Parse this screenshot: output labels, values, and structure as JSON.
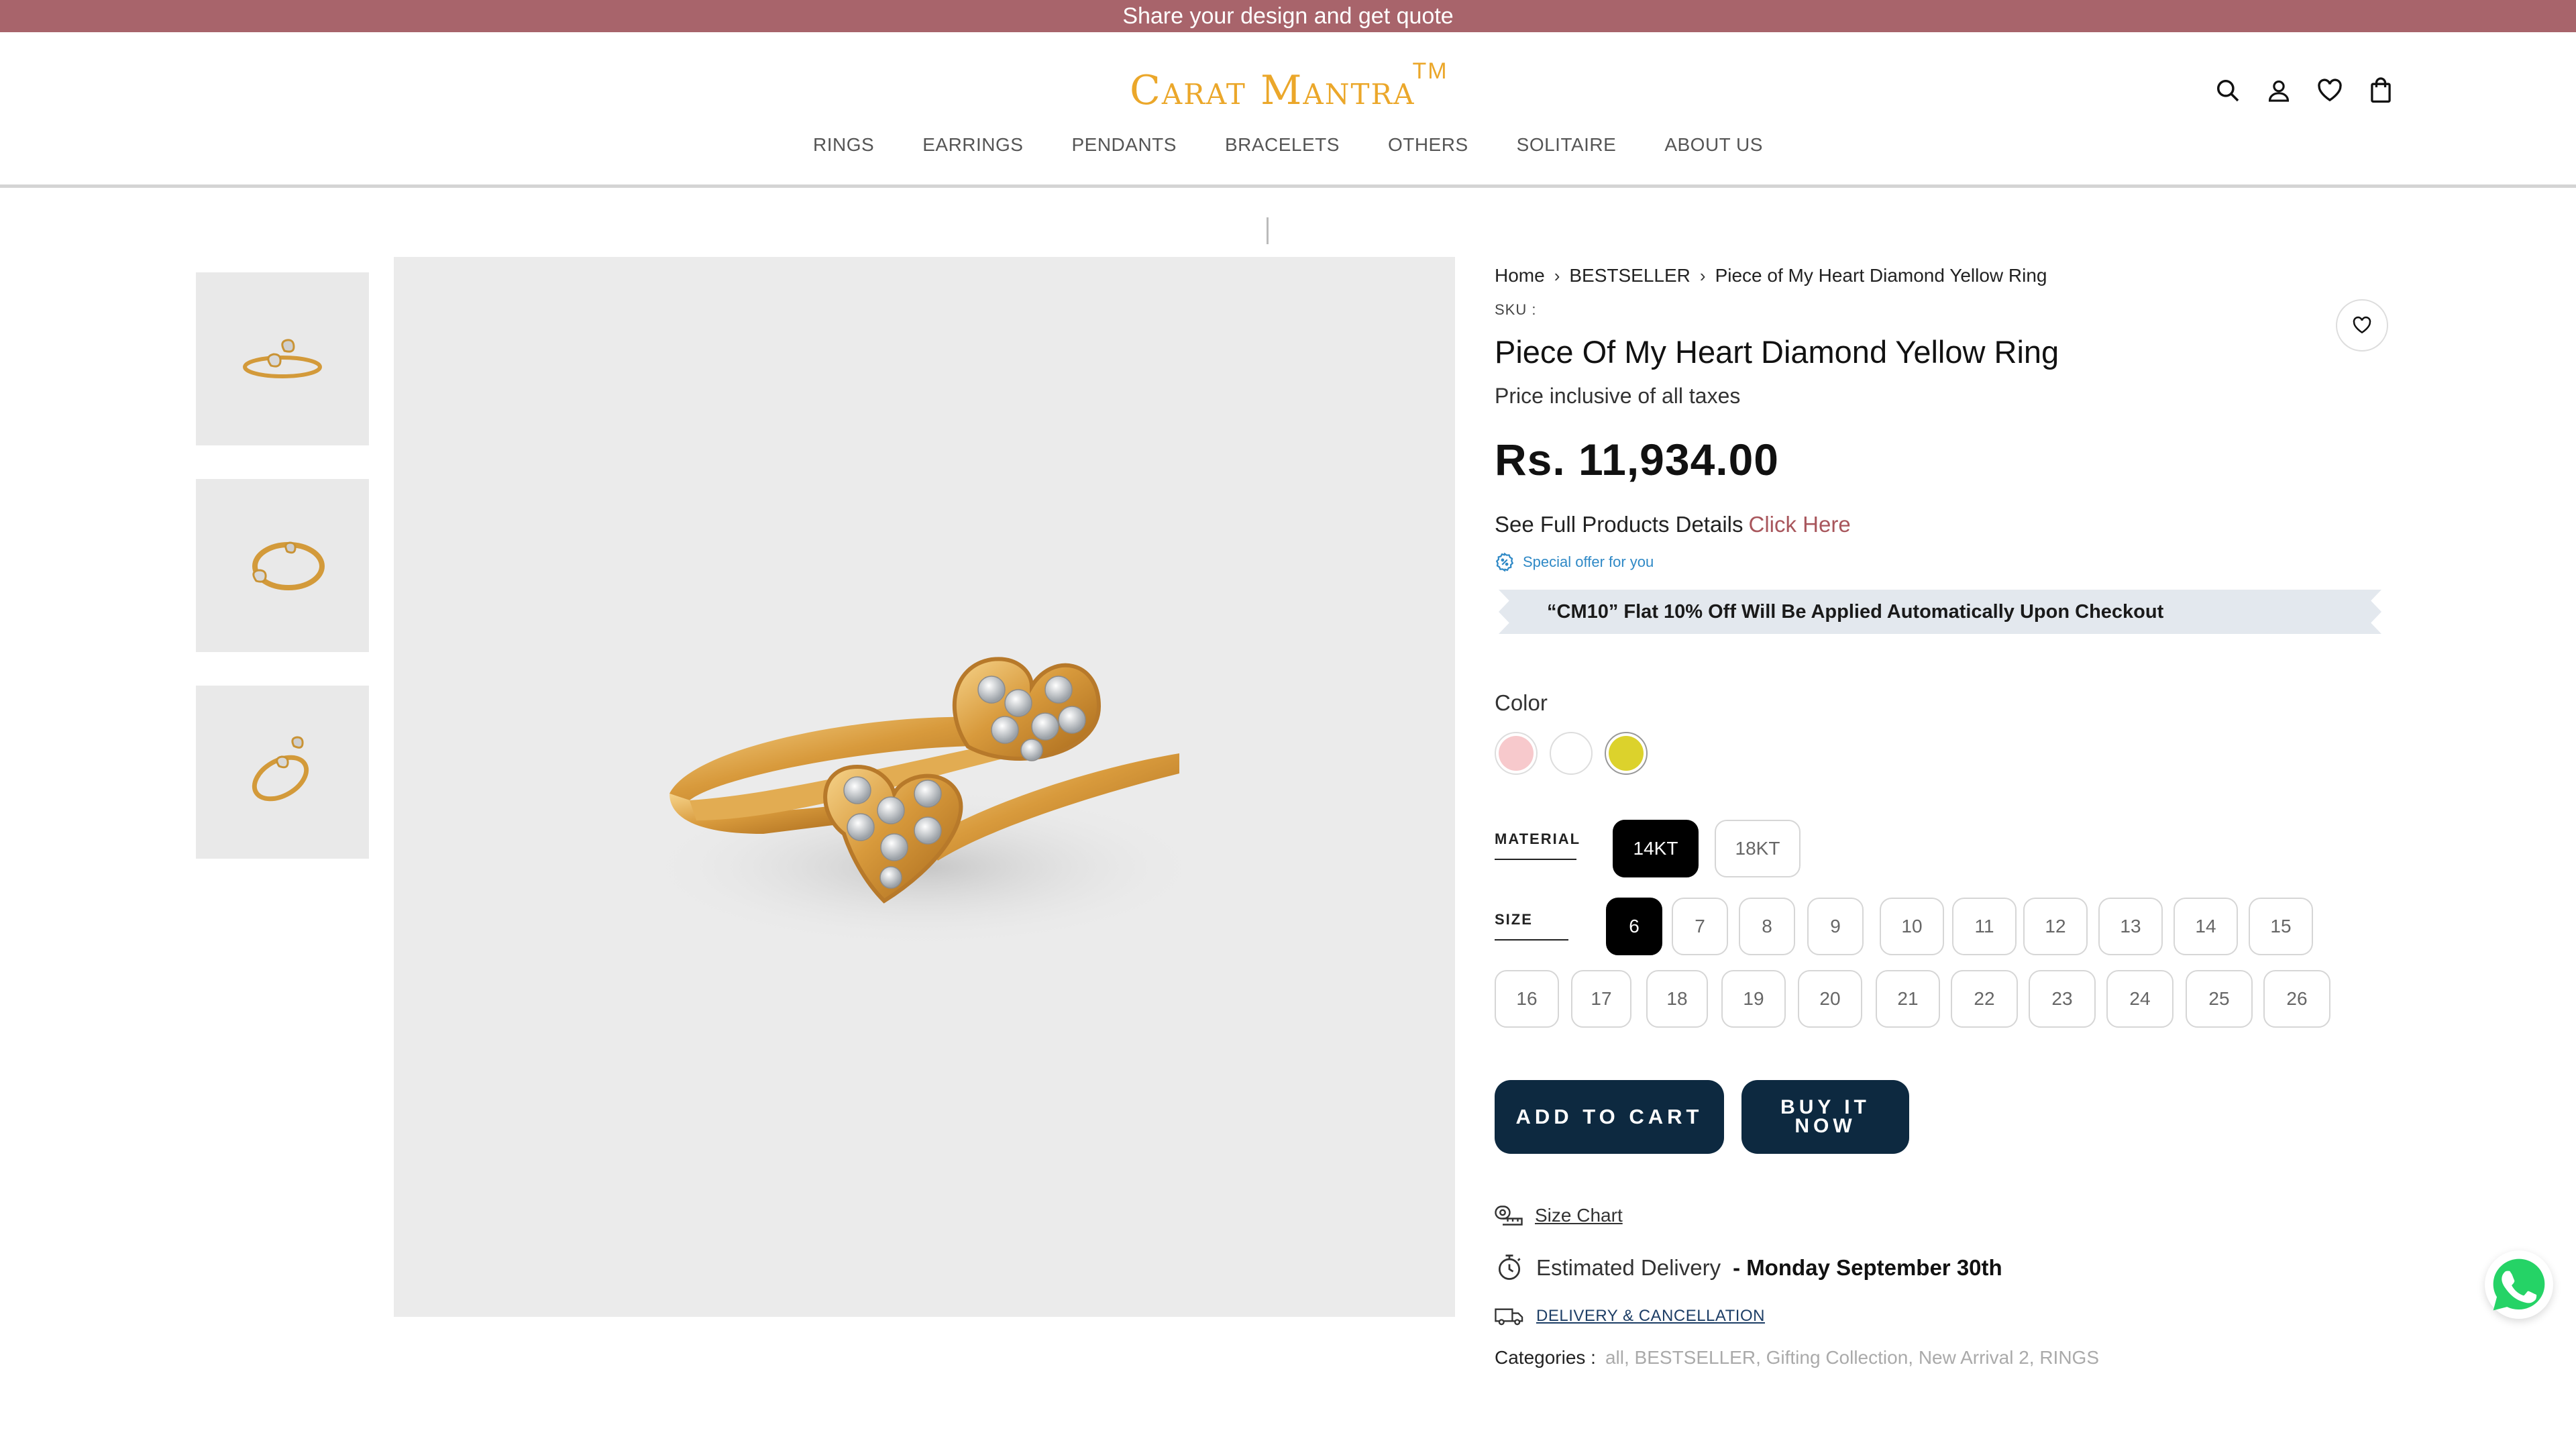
{
  "announcement": "Share your design and get quote",
  "brand": {
    "name": "Carat Mantra",
    "tm": "TM",
    "color": "#eba72a"
  },
  "nav": [
    "RINGS",
    "EARRINGS",
    "PENDANTS",
    "BRACELETS",
    "OTHERS",
    "SOLITAIRE",
    "ABOUT US"
  ],
  "header_icons": [
    "search-icon",
    "account-icon",
    "wishlist-icon",
    "cart-bag-icon"
  ],
  "breadcrumb": [
    "Home",
    "BESTSELLER",
    "Piece of My Heart Diamond Yellow Ring"
  ],
  "product": {
    "sku_label": "SKU :",
    "title": "Piece Of My Heart Diamond Yellow Ring",
    "tax_note": "Price inclusive of all taxes",
    "price": "Rs. 11,934.00",
    "details_text": "See Full Products Details",
    "details_link": "Click Here",
    "offer_tag": "Special offer for you",
    "offer_banner": "“CM10” Flat 10% Off Will Be Applied Automatically Upon Checkout"
  },
  "color": {
    "label": "Color",
    "options": [
      {
        "name": "rose",
        "hex": "#f7c9cc"
      },
      {
        "name": "white",
        "hex": "#ffffff"
      },
      {
        "name": "yellow",
        "hex": "#dcd22c"
      }
    ],
    "selected": "yellow"
  },
  "material": {
    "label": "MATERIAL",
    "options": [
      "14KT",
      "18KT"
    ],
    "selected": "14KT"
  },
  "size": {
    "label": "SIZE",
    "options": [
      "6",
      "7",
      "8",
      "9",
      "10",
      "11",
      "12",
      "13",
      "14",
      "15",
      "16",
      "17",
      "18",
      "19",
      "20",
      "21",
      "22",
      "23",
      "24",
      "25",
      "26"
    ],
    "selected": "6"
  },
  "buttons": {
    "add_to_cart": "ADD TO CART",
    "buy_now": "BUY IT NOW"
  },
  "size_chart": "Size Chart",
  "delivery": {
    "label": "Estimated Delivery",
    "date": "- Monday September 30th"
  },
  "delivery_cancellation": "DELIVERY & CANCELLATION",
  "categories": {
    "label": "Categories :",
    "list": "all, BESTSELLER, Gifting Collection, New Arrival 2, RINGS"
  },
  "colors": {
    "announce_bg": "#a8646b",
    "button_bg": "#0d2940",
    "link": "#a8565c"
  }
}
